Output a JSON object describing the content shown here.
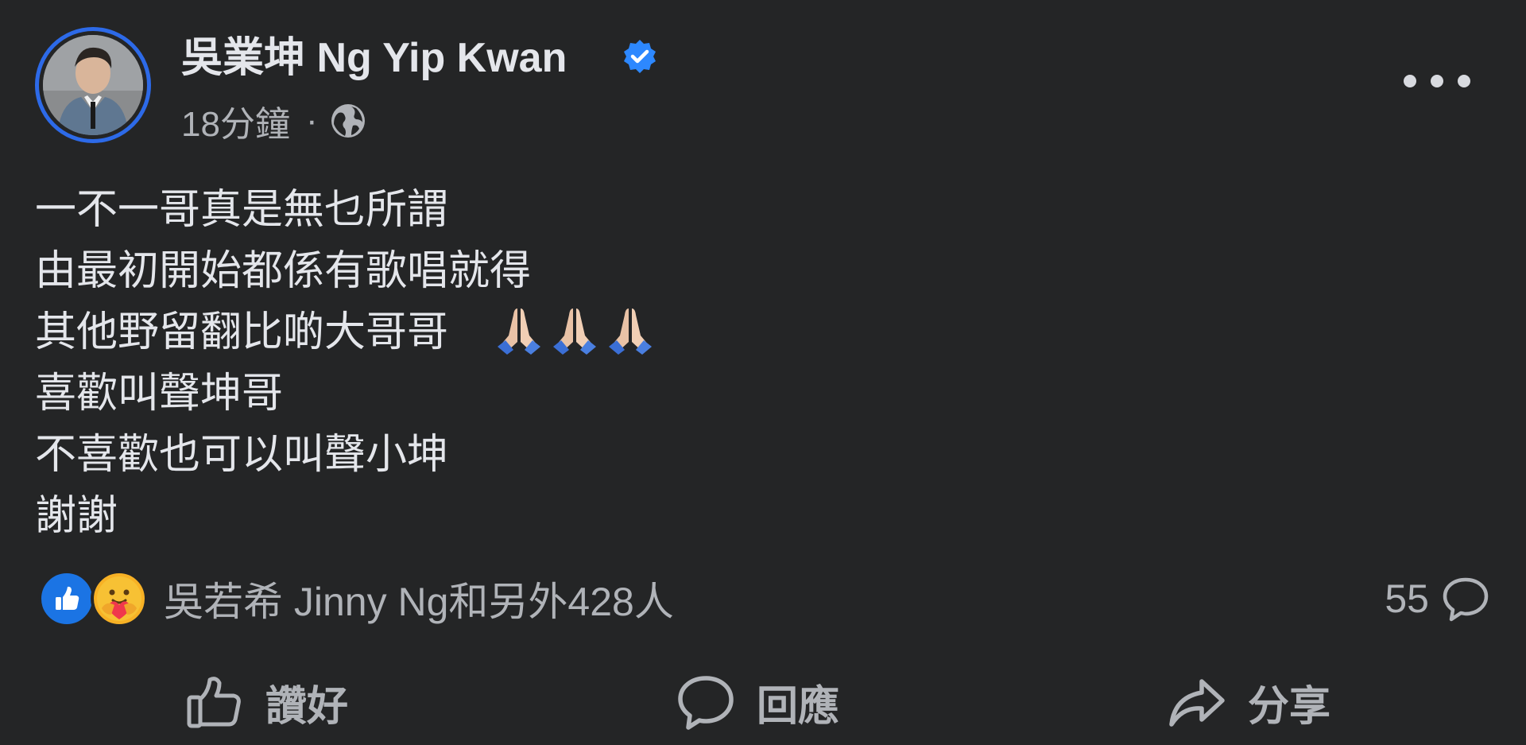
{
  "post": {
    "author_name": "吳業坤 Ng Yip Kwan",
    "timestamp": "18分鐘",
    "separator": "·",
    "audience_icon": "globe-icon",
    "verified_icon": "verified-badge-icon",
    "text_lines": [
      "一不一哥真是無乜所謂",
      "由最初開始都係有歌唱就得",
      "其他野留翻比啲大哥哥",
      "喜歡叫聲坤哥",
      "不喜歡也可以叫聲小坤",
      "謝謝"
    ],
    "emoji": [
      "folded-hands-icon",
      "folded-hands-icon",
      "folded-hands-icon"
    ]
  },
  "reactions": {
    "icons": [
      "like-reaction-icon",
      "care-reaction-icon"
    ],
    "summary": "吳若希 Jinny Ng和另外428人",
    "comment_count": "55"
  },
  "actions": {
    "like_label": "讚好",
    "comment_label": "回應",
    "share_label": "分享"
  },
  "colors": {
    "background": "#242526",
    "primary_text": "#e4e6eb",
    "secondary_text": "#b0b3b8",
    "accent_blue": "#1b74e4"
  }
}
